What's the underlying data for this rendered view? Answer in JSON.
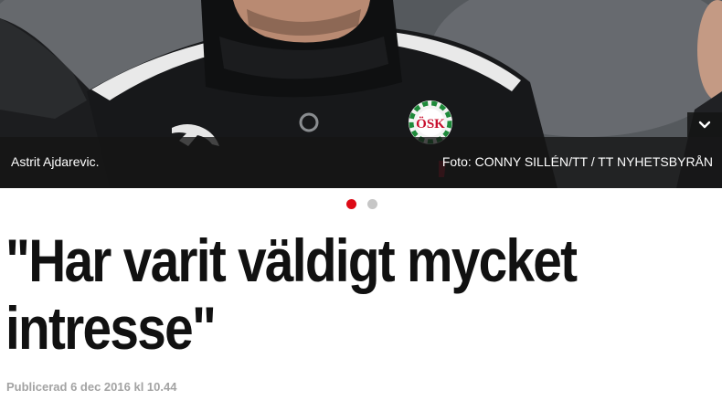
{
  "hero": {
    "caption": "Astrit Ajdarevic.",
    "credit": "Foto: CONNY SILLÉN/TT / TT NYHETSBYRÅN",
    "expand_icon": "chevron-down-icon",
    "crest_text": "ÖSK"
  },
  "slideshow": {
    "total": 2,
    "active_index": 0,
    "active_color": "#dd0a16",
    "inactive_color": "#c6c6c6"
  },
  "article": {
    "headline": "\"Har varit väldigt mycket intresse\"",
    "published": "Publicerad 6 dec 2016 kl 10.44"
  }
}
